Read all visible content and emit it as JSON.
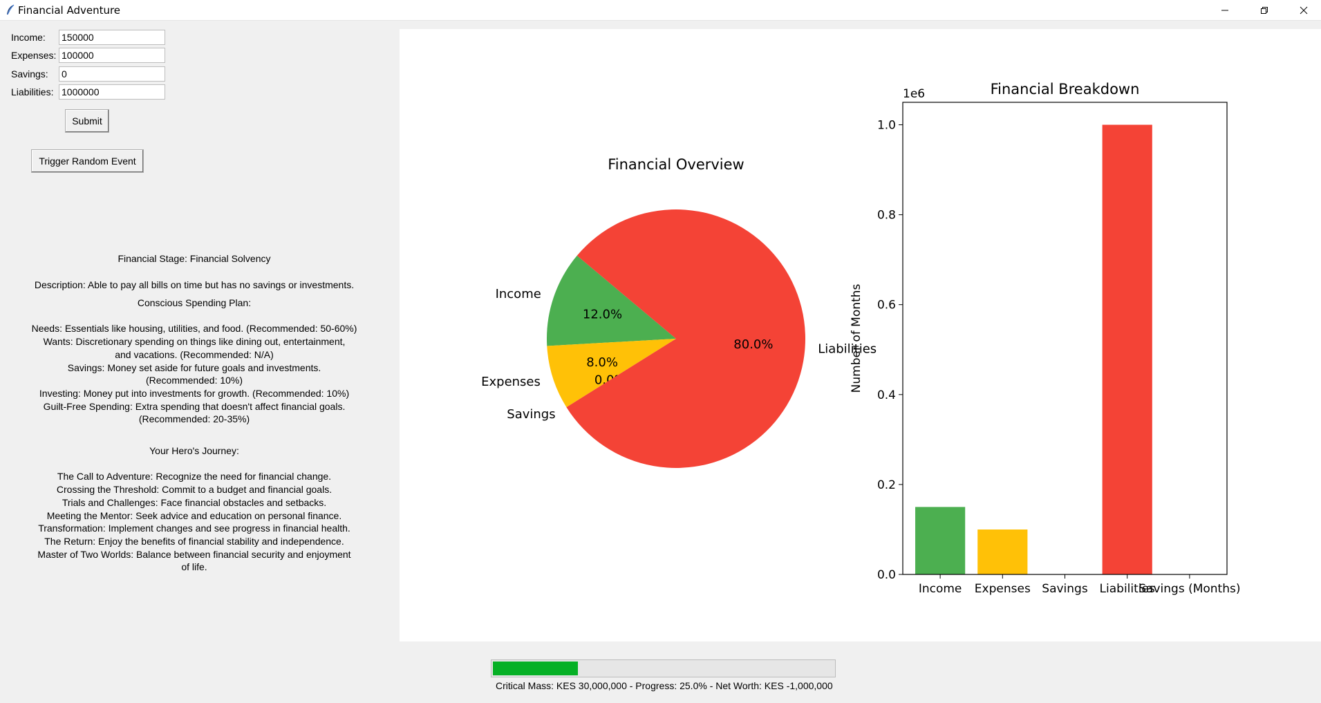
{
  "window": {
    "title": "Financial Adventure"
  },
  "form": {
    "income_label": "Income:",
    "income_value": "150000",
    "expenses_label": "Expenses:",
    "expenses_value": "100000",
    "savings_label": "Savings:",
    "savings_value": "0",
    "liabilities_label": "Liabilities:",
    "liabilities_value": "1000000",
    "submit_label": "Submit",
    "random_event_label": "Trigger Random Event"
  },
  "info": {
    "stage": "Financial Stage: Financial Solvency",
    "description": "Description: Able to pay all bills on time but has no savings or investments.",
    "plan_title": "Conscious Spending Plan:",
    "plan_lines": [
      "Needs: Essentials like housing, utilities, and food. (Recommended: 50-60%)",
      "Wants: Discretionary spending on things like dining out, entertainment,",
      "and vacations. (Recommended: N/A)",
      "Savings: Money set aside for future goals and investments.",
      "(Recommended: 10%)",
      "Investing: Money put into investments for growth. (Recommended: 10%)",
      "Guilt-Free Spending: Extra spending that doesn't affect financial goals.",
      "(Recommended: 20-35%)"
    ],
    "journey_title": "Your Hero's Journey:",
    "journey_lines": [
      "The Call to Adventure: Recognize the need for financial change.",
      "Crossing the Threshold: Commit to a budget and financial goals.",
      "Trials and Challenges: Face financial obstacles and setbacks.",
      "Meeting the Mentor: Seek advice and education on personal finance.",
      "Transformation: Implement changes and see progress in financial health.",
      "The Return: Enjoy the benefits of financial stability and independence.",
      "Master of Two Worlds: Balance between financial security and enjoyment",
      "of life."
    ]
  },
  "progress": {
    "fraction": 0.25,
    "color": "#06b025"
  },
  "status_text": "Critical Mass: KES 30,000,000 - Progress: 25.0% - Net Worth: KES -1,000,000",
  "chart_data": [
    {
      "type": "pie",
      "title": "Financial Overview",
      "slices": [
        {
          "label": "Income",
          "value": 150000,
          "pct_label": "12.0%",
          "color": "#4caf50"
        },
        {
          "label": "Expenses",
          "value": 100000,
          "pct_label": "8.0%",
          "color": "#ffc107"
        },
        {
          "label": "Savings",
          "value": 0,
          "pct_label": "0.0%",
          "color": "#2196f3"
        },
        {
          "label": "Liabilities",
          "value": 1000000,
          "pct_label": "80.0%",
          "color": "#f44336"
        }
      ],
      "start_angle_deg": 140
    },
    {
      "type": "bar",
      "title": "Financial Breakdown",
      "categories": [
        "Income",
        "Expenses",
        "Savings",
        "Liabilities",
        "Savings (Months)"
      ],
      "values": [
        150000,
        100000,
        0,
        1000000,
        0
      ],
      "colors": [
        "#4caf50",
        "#ffc107",
        "#2196f3",
        "#f44336",
        "#9c27b0"
      ],
      "ylabel": "Number of Months",
      "ylim": [
        0,
        1050000
      ],
      "yticks": [
        0,
        200000,
        400000,
        600000,
        800000,
        1000000
      ],
      "ytick_labels": [
        "0.0",
        "0.2",
        "0.4",
        "0.6",
        "0.8",
        "1.0"
      ],
      "offset_label": "1e6"
    }
  ]
}
